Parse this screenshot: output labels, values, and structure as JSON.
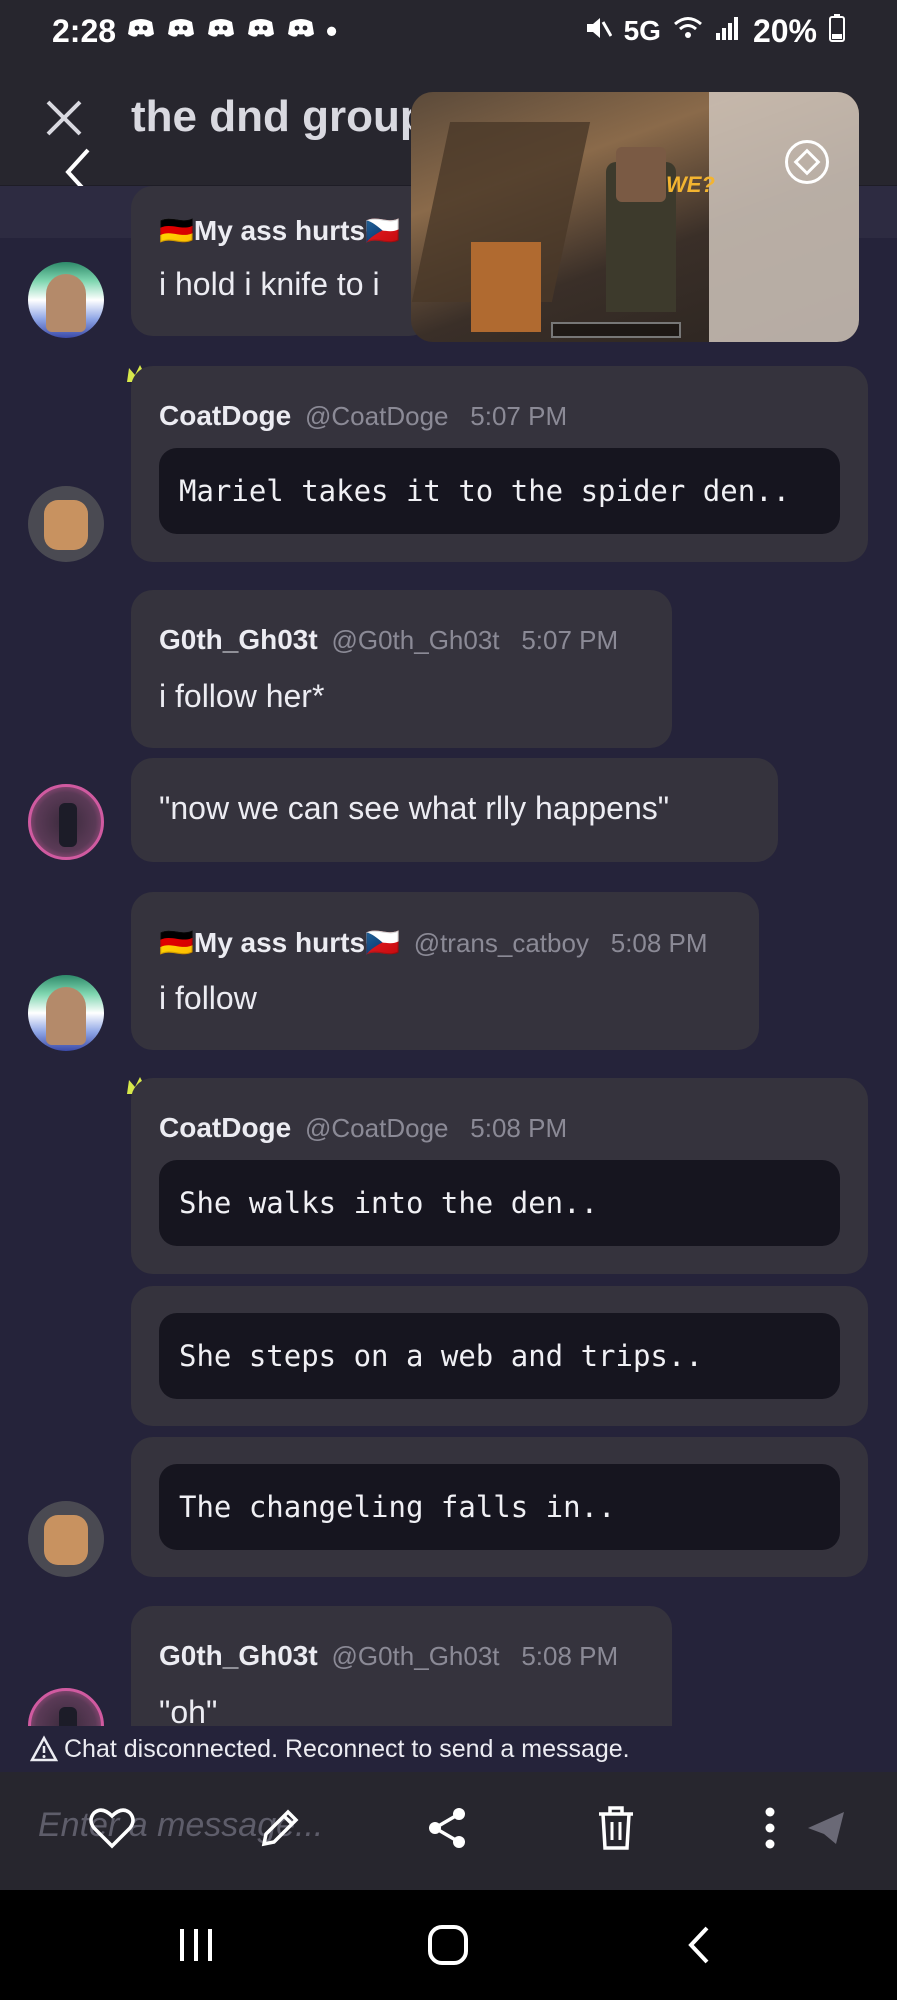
{
  "status_bar": {
    "time": "2:28",
    "dot": "•",
    "network": "5G",
    "battery": "20%",
    "icons": [
      "discord-icon",
      "discord-icon",
      "discord-icon",
      "discord-icon",
      "discord-icon",
      "mute-icon",
      "wifi-icon",
      "signal-icon",
      "battery-icon"
    ]
  },
  "header": {
    "title": "the dnd group",
    "close_icon": "close-icon",
    "back_icon": "back-icon"
  },
  "pip": {
    "overlay_text": "WE?",
    "rotate_icon": "rotate-icon"
  },
  "messages": [
    {
      "type": "text",
      "author": "🇩🇪My ass hurts🇨🇿",
      "text": "i hold i knife to i"
    },
    {
      "type": "code",
      "author": "CoatDoge",
      "handle": "@CoatDoge",
      "time": "5:07 PM",
      "text": "Mariel takes it to the spider den.."
    },
    {
      "type": "text",
      "author": "G0th_Gh03t",
      "handle": "@G0th_Gh03t",
      "time": "5:07 PM",
      "text": "i follow her*"
    },
    {
      "type": "text",
      "text": "\"now we can see what rlly happens\""
    },
    {
      "type": "text",
      "author": "🇩🇪My ass hurts🇨🇿",
      "handle": "@trans_catboy",
      "time": "5:08 PM",
      "text": "i follow"
    },
    {
      "type": "code",
      "author": "CoatDoge",
      "handle": "@CoatDoge",
      "time": "5:08 PM",
      "text": "She walks into the den.."
    },
    {
      "type": "code",
      "text": "She steps on a web and trips.."
    },
    {
      "type": "code",
      "text": "The changeling falls in.."
    },
    {
      "type": "text",
      "author": "G0th_Gh03t",
      "handle": "@G0th_Gh03t",
      "time": "5:08 PM",
      "text": "\"oh\""
    }
  ],
  "disconnect_text": "Chat disconnected. Reconnect to send a message.",
  "input": {
    "placeholder": "Enter a message...",
    "icons": [
      "heart-icon",
      "pencil-icon",
      "share-icon",
      "trash-icon",
      "more-icon",
      "send-icon"
    ]
  },
  "nav": {
    "icons": [
      "recents-icon",
      "home-icon",
      "back-icon"
    ]
  },
  "colors": {
    "background": "#25233a",
    "card": "#35333d",
    "code_bg": "#16151f",
    "crown": "#d7e84b"
  }
}
